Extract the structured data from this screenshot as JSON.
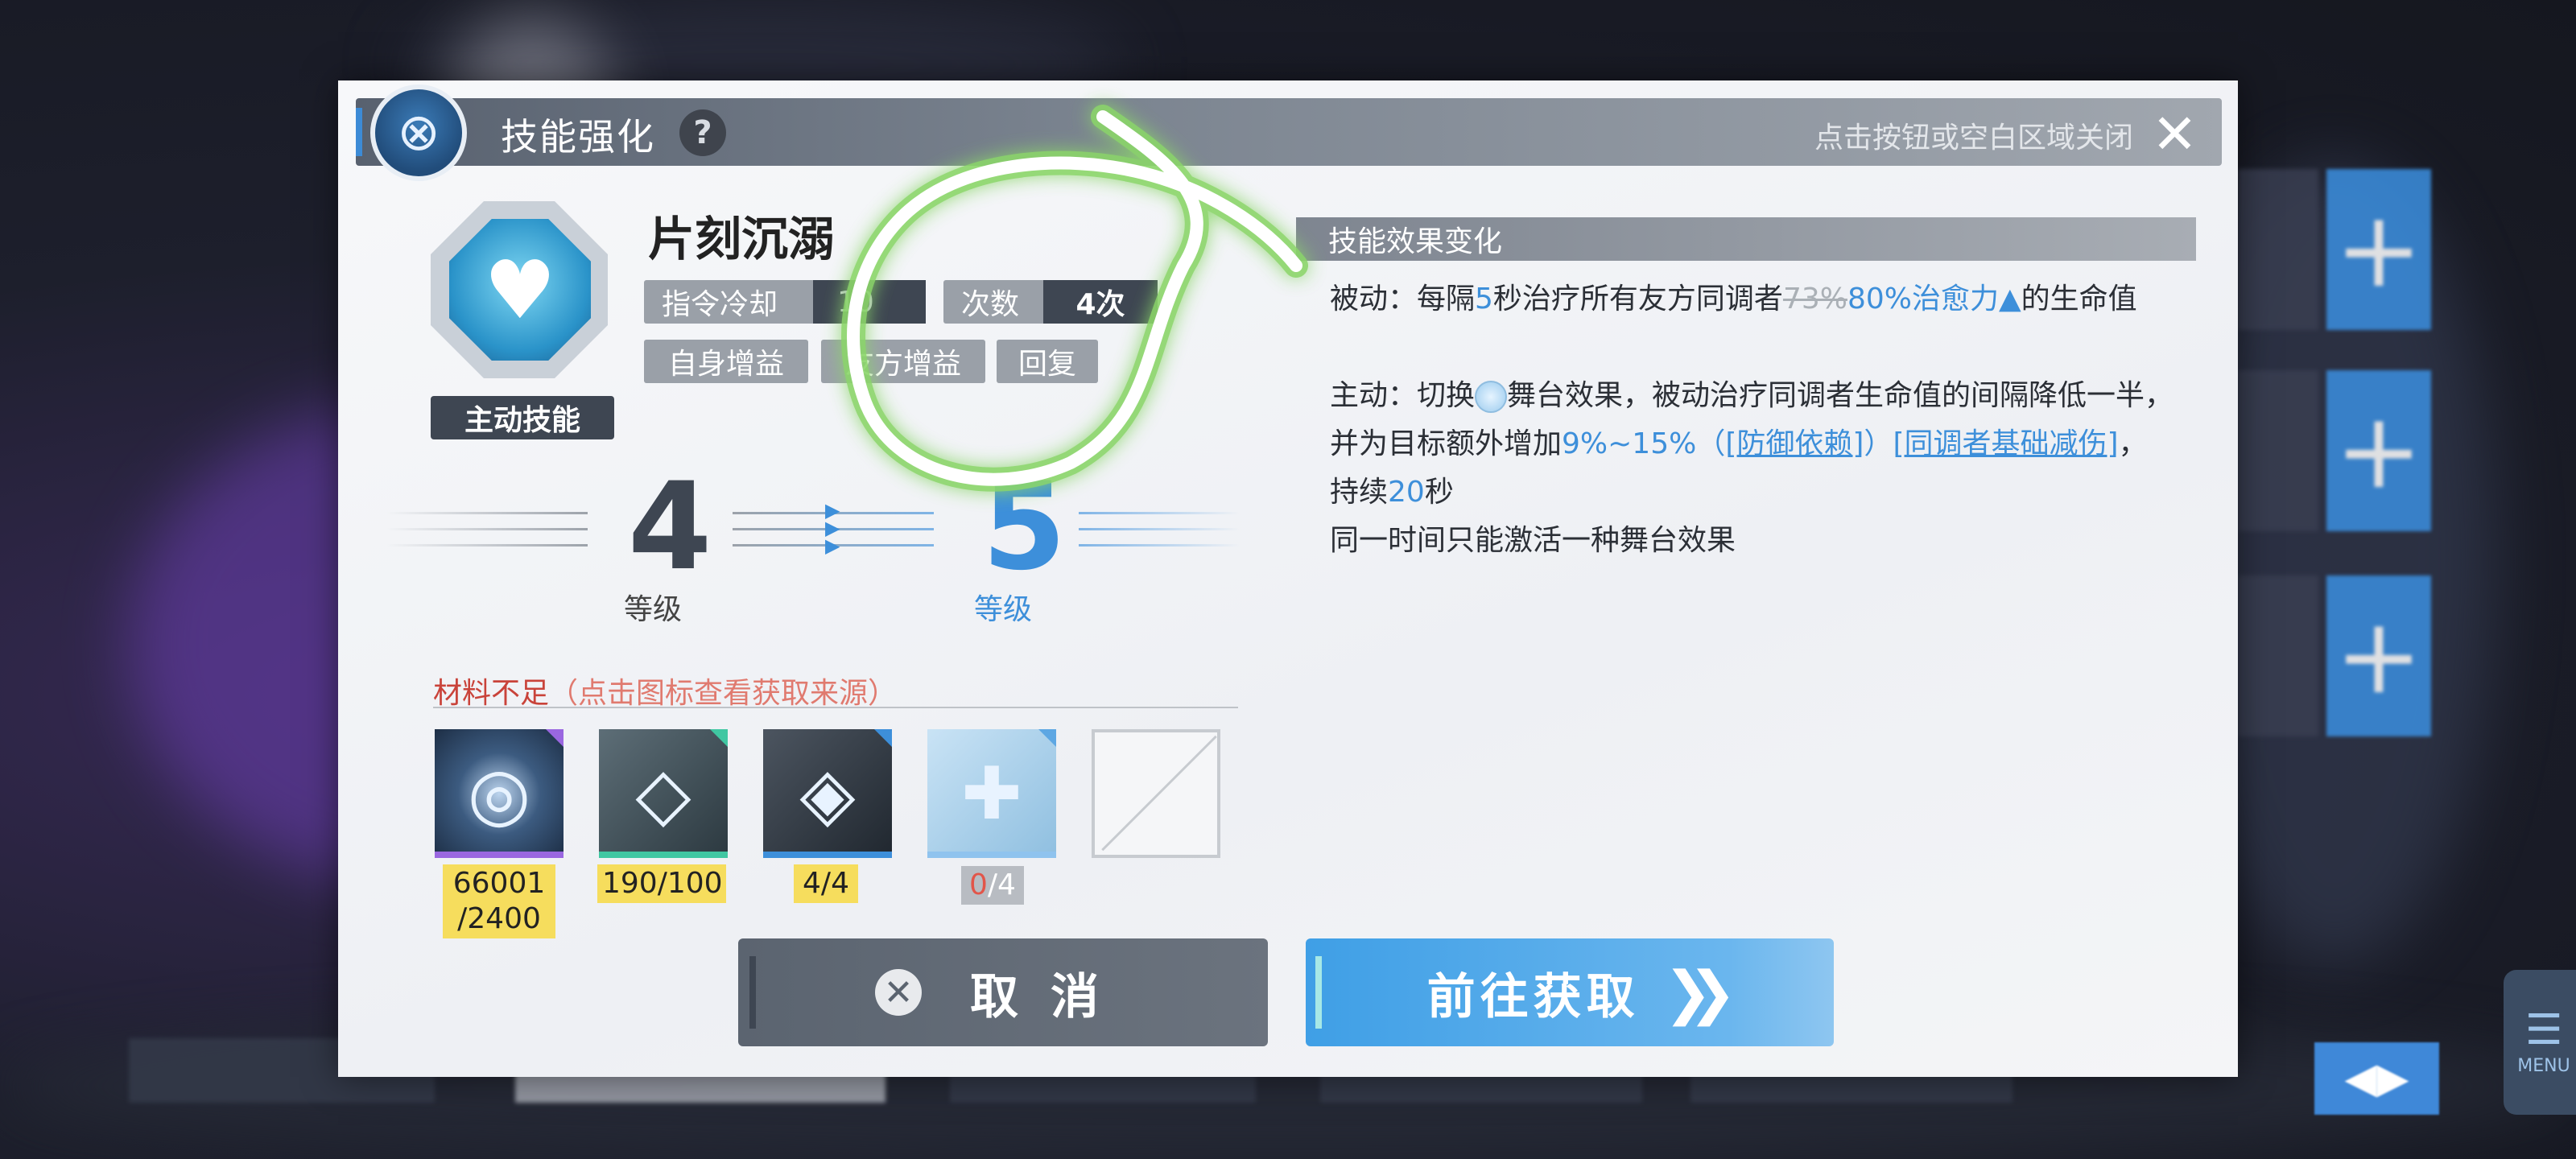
{
  "dialog": {
    "title": "技能强化",
    "help_glyph": "?",
    "close_hint": "点击按钮或空白区域关闭",
    "close_glyph": "✕",
    "emblem_glyph": "⊗"
  },
  "skill": {
    "name": "片刻沉溺",
    "type_label": "主动技能",
    "cooldown_label": "指令冷却",
    "cooldown_value": "10",
    "count_label": "次数",
    "count_value": "4次",
    "tags": [
      "自身增益",
      "友方增益",
      "回复"
    ],
    "icon_glyph": "♥"
  },
  "level": {
    "current": "4",
    "next": "5",
    "label": "等级"
  },
  "materials": {
    "title_main": "材料不足",
    "title_hint": "（点击图标查看获取来源）",
    "items": [
      {
        "name": "material-1",
        "glyph": "◎",
        "qty": "66001\n/2400"
      },
      {
        "name": "material-2",
        "glyph": "◇",
        "qty": "190/100"
      },
      {
        "name": "material-3",
        "glyph": "◈",
        "qty": "4/4"
      },
      {
        "name": "material-4",
        "glyph": "✚",
        "qty_have": "0",
        "qty_need": "/4"
      }
    ]
  },
  "effects": {
    "header": "技能效果变化",
    "passive": {
      "prefix": "被动：每隔",
      "interval": "5",
      "mid": "秒治疗所有友方同调者",
      "old_value": "73%",
      "new_value": "80%治愈力",
      "up_glyph": "▲",
      "suffix": "的生命值"
    },
    "active": {
      "prefix": "主动：切换",
      "mid": "舞台效果，被动治疗同调者生命值的间隔降低一半，并为目标额外增加",
      "range": "9%~15%",
      "open_paren": "（",
      "link1": "[防御依赖]",
      "close_paren": "）",
      "link2": "[同调者基础减伤]",
      "mid2": "，持续",
      "duration": "20",
      "suffix": "秒"
    },
    "note": "同一时间只能激活一种舞台效果"
  },
  "buttons": {
    "cancel": "取消",
    "cancel_glyph": "✕",
    "go": "前往获取",
    "go_glyph": "❯❯"
  },
  "background": {
    "menu_label": "MENU",
    "menu_glyph": "☰",
    "plus_glyph": "+"
  }
}
